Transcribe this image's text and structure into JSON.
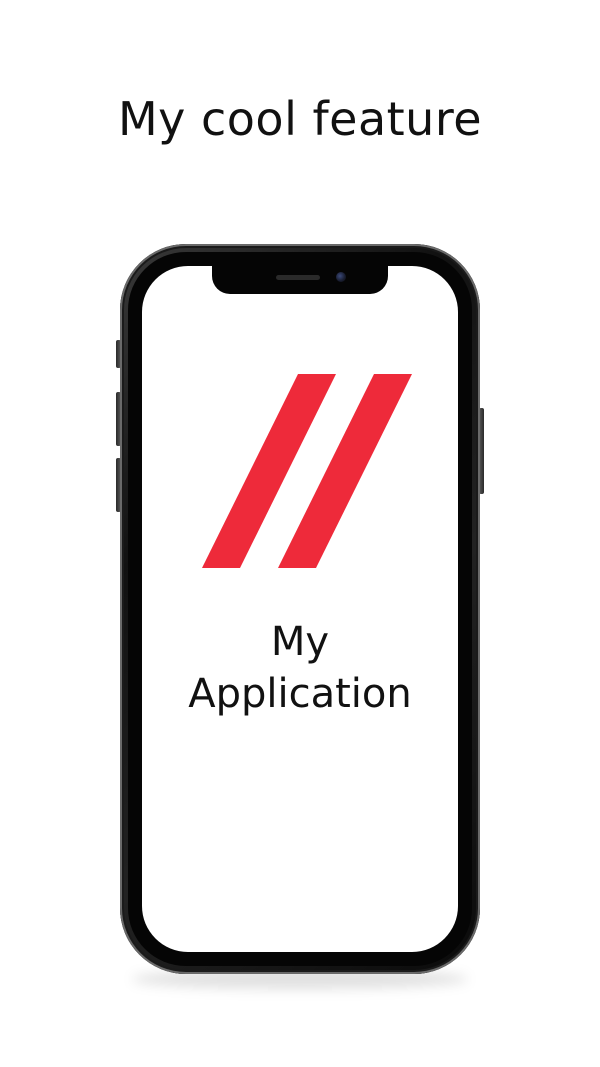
{
  "headline": "My cool feature",
  "app": {
    "name_line1": "My",
    "name_line2": "Application",
    "logo_icon": "double-slash-logo-icon",
    "brand_color": "#EE2A3A"
  },
  "device": {
    "frame_color": "#111111",
    "screen_color": "#FFFFFF"
  }
}
